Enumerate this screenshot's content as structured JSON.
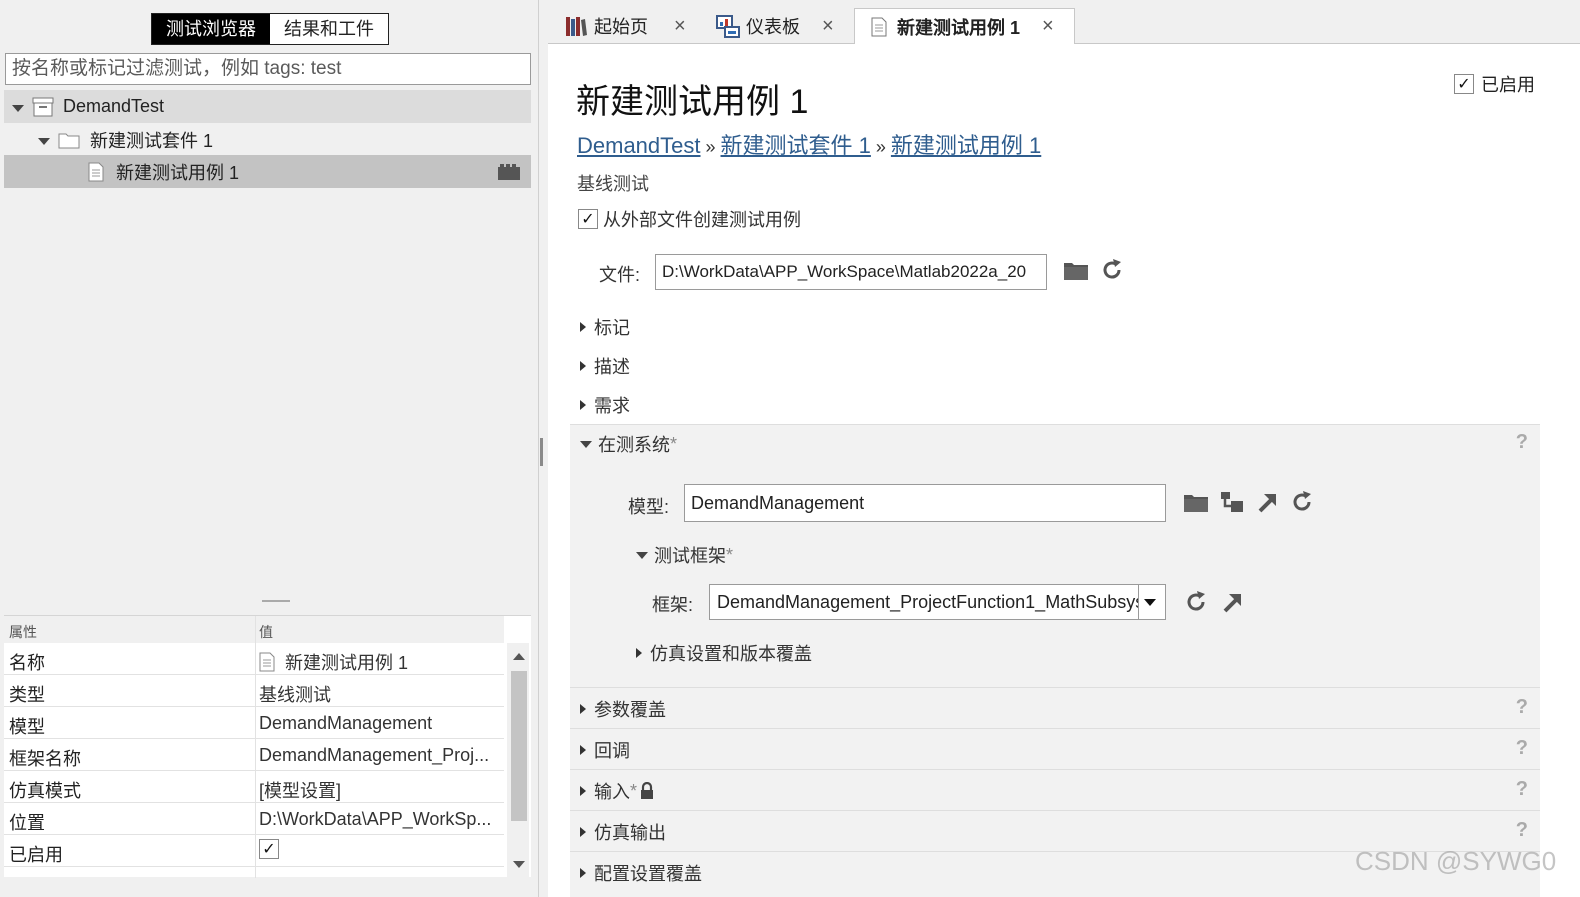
{
  "left": {
    "toggle": {
      "browser": "测试浏览器",
      "results": "结果和工件"
    },
    "filter_placeholder": "按名称或标记过滤测试，例如 tags: test",
    "tree": {
      "file": "DemandTest",
      "suite": "新建测试套件 1",
      "case": "新建测试用例 1"
    },
    "props": {
      "header_attr": "属性",
      "header_value": "值",
      "rows": [
        {
          "k": "名称",
          "v": "新建测试用例 1"
        },
        {
          "k": "类型",
          "v": "基线测试"
        },
        {
          "k": "模型",
          "v": "DemandManagement"
        },
        {
          "k": "框架名称",
          "v": "DemandManagement_Proj..."
        },
        {
          "k": "仿真模式",
          "v": "[模型设置]"
        },
        {
          "k": "位置",
          "v": "D:\\WorkData\\APP_WorkSp..."
        },
        {
          "k": "已启用",
          "v": "✓"
        }
      ]
    }
  },
  "tabs": [
    {
      "label": "起始页",
      "icon": "library-books-icon"
    },
    {
      "label": "仪表板",
      "icon": "dashboard-icon"
    },
    {
      "label": "新建测试用例 1",
      "icon": "document-icon"
    }
  ],
  "editor": {
    "title": "新建测试用例 1",
    "enabled_label": "已启用",
    "breadcrumb": [
      "DemandTest",
      "新建测试套件 1",
      "新建测试用例 1"
    ],
    "breadcrumb_sep": "»",
    "subtitle": "基线测试",
    "external_checkbox_label": "从外部文件创建测试用例",
    "file_label": "文件:",
    "file_value": "D:\\WorkData\\APP_WorkSpace\\Matlab2022a_20",
    "collapsed": [
      "标记",
      "描述",
      "需求"
    ],
    "sut": {
      "title": "在测系统",
      "required_mark": "*",
      "model_label": "模型:",
      "model_value": "DemandManagement",
      "harness_title": "测试框架",
      "harness_label": "框架:",
      "harness_value": "DemandManagement_ProjectFunction1_MathSubsys",
      "sim_settings": "仿真设置和版本覆盖"
    },
    "sections": [
      {
        "title": "参数覆盖"
      },
      {
        "title": "回调"
      },
      {
        "title": "输入",
        "required": "*"
      },
      {
        "title": "仿真输出"
      },
      {
        "title": "配置设置覆盖"
      }
    ],
    "help": "?"
  },
  "watermark": "CSDN @SYWG0"
}
